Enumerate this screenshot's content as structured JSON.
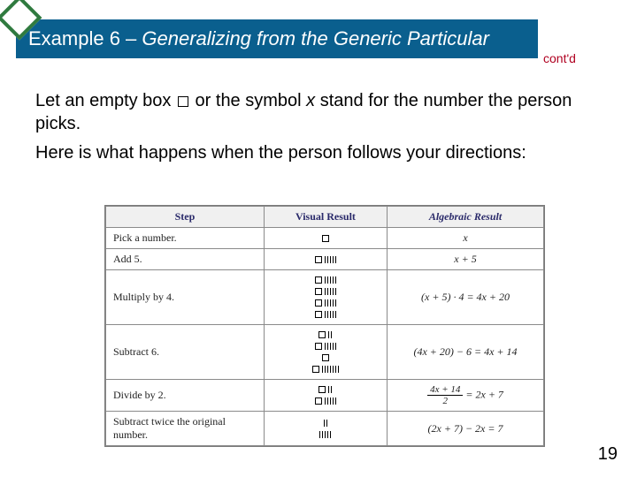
{
  "header": {
    "example_label": "Example 6 – ",
    "title_italic": "Generalizing from the Generic Particular",
    "contd": "cont'd"
  },
  "body": {
    "p1_a": "Let an empty box ",
    "p1_b": " or the symbol ",
    "p1_x": "x",
    "p1_c": " stand for the number the person picks.",
    "p2": "Here is what happens when the person follows your directions:"
  },
  "table": {
    "headers": {
      "step": "Step",
      "visual": "Visual Result",
      "algebraic": "Algebraic Result"
    },
    "rows": [
      {
        "step": "Pick a number.",
        "alg": "x",
        "vis": [
          {
            "sq": 1,
            "t": 0
          }
        ]
      },
      {
        "step": "Add 5.",
        "alg": "x + 5",
        "vis": [
          {
            "sq": 1,
            "t": 5
          }
        ]
      },
      {
        "step": "Multiply by 4.",
        "alg": "(x + 5) · 4 = 4x + 20",
        "vis": [
          {
            "sq": 1,
            "t": 5
          },
          {
            "sq": 1,
            "t": 5
          },
          {
            "sq": 1,
            "t": 5
          },
          {
            "sq": 1,
            "t": 5
          }
        ]
      },
      {
        "step": "Subtract 6.",
        "alg": "(4x + 20) − 6 = 4x + 14",
        "vis": [
          {
            "sq": 1,
            "t": 2
          },
          {
            "sq": 1,
            "t": 5
          },
          {
            "sq": 1,
            "t": 0
          },
          {
            "sq": 1,
            "t": 7
          }
        ]
      },
      {
        "step": "Divide by 2.",
        "alg_frac": {
          "num": "4x + 14",
          "den": "2",
          "rhs": " = 2x + 7"
        },
        "vis": [
          {
            "sq": 1,
            "t": 2
          },
          {
            "sq": 1,
            "t": 5
          }
        ]
      },
      {
        "step": "Subtract twice the original number.",
        "alg": "(2x + 7) − 2x = 7",
        "vis": [
          {
            "sq": 0,
            "t": 2
          },
          {
            "sq": 0,
            "t": 5
          }
        ]
      }
    ]
  },
  "slide_number": "19"
}
